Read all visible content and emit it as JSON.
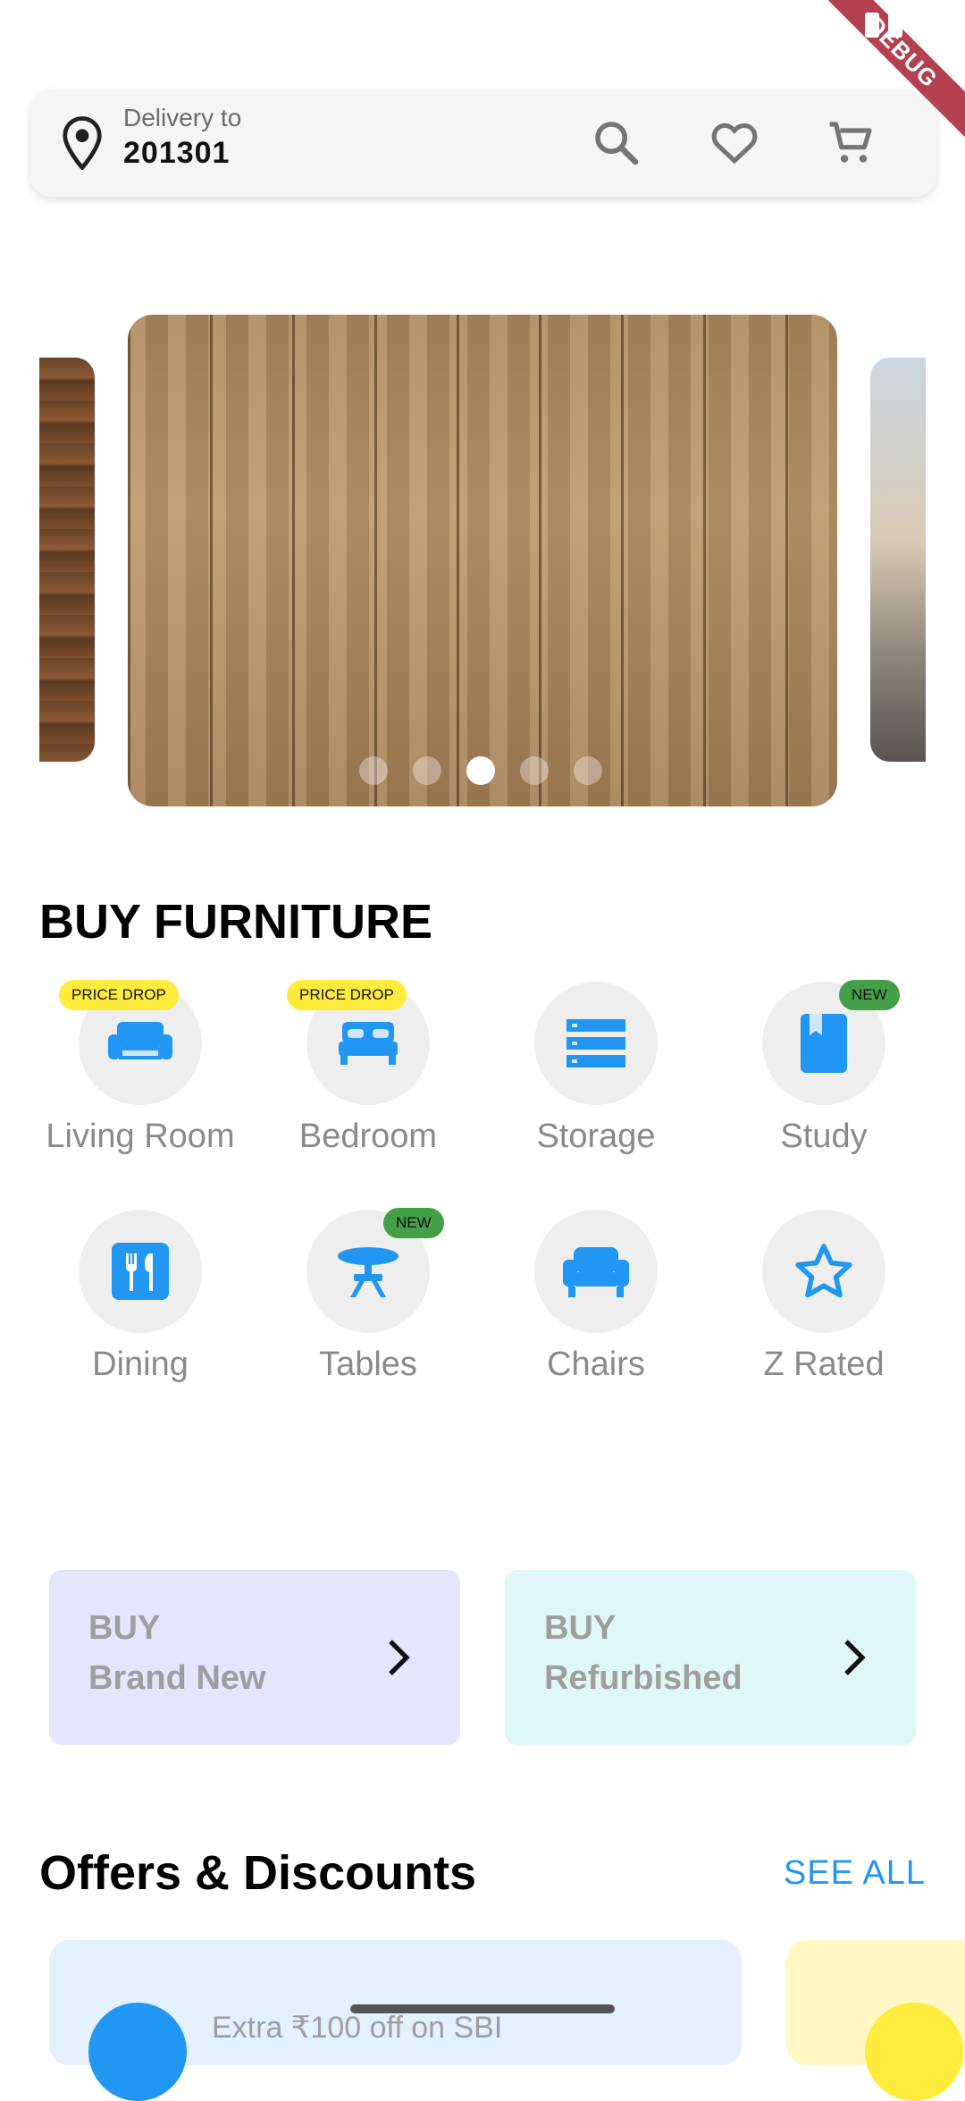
{
  "debug_banner": "DEBUG",
  "header": {
    "delivery_label": "Delivery to",
    "pincode": "201301",
    "icons": [
      "location-pin-icon",
      "search-icon",
      "heart-icon",
      "cart-icon"
    ]
  },
  "carousel": {
    "slide_count": 5,
    "active_index": 2
  },
  "categories_title": "BUY FURNITURE",
  "categories": [
    {
      "label": "Living Room",
      "badge": "PRICE DROP",
      "icon": "sofa-icon"
    },
    {
      "label": "Bedroom",
      "badge": "PRICE DROP",
      "icon": "bed-icon"
    },
    {
      "label": "Storage",
      "badge": "",
      "icon": "storage-icon"
    },
    {
      "label": "Study",
      "badge": "NEW",
      "icon": "book-icon"
    },
    {
      "label": "Dining",
      "badge": "",
      "icon": "dining-icon"
    },
    {
      "label": "Tables",
      "badge": "NEW",
      "icon": "table-icon"
    },
    {
      "label": "Chairs",
      "badge": "",
      "icon": "chair-icon"
    },
    {
      "label": "Z Rated",
      "badge": "",
      "icon": "star-icon"
    }
  ],
  "buy_options": [
    {
      "line1": "BUY",
      "line2": "Brand New"
    },
    {
      "line1": "BUY",
      "line2": "Refurbished"
    }
  ],
  "offers": {
    "title": "Offers & Discounts",
    "see_all": "SEE ALL",
    "first_offer_text": "Extra ₹100 off on SBI"
  },
  "colors": {
    "accent": "#2196f3",
    "price_drop_badge": "#ffeb3b",
    "new_badge": "#43a047"
  }
}
